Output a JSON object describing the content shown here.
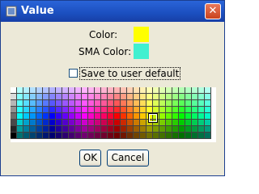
{
  "window": {
    "title": "Value",
    "close_glyph": "✕"
  },
  "color_label": "Color:",
  "sma_color_label": "SMA Color:",
  "colors": {
    "color": "#ffff00",
    "sma_color": "#40f0d0",
    "palette_selected": "#ffff80"
  },
  "save_default_label": "Save to user default",
  "save_default_checked": false,
  "ok_label": "OK",
  "cancel_label": "Cancel",
  "icons": [
    "app-window-icon",
    "close-icon"
  ]
}
